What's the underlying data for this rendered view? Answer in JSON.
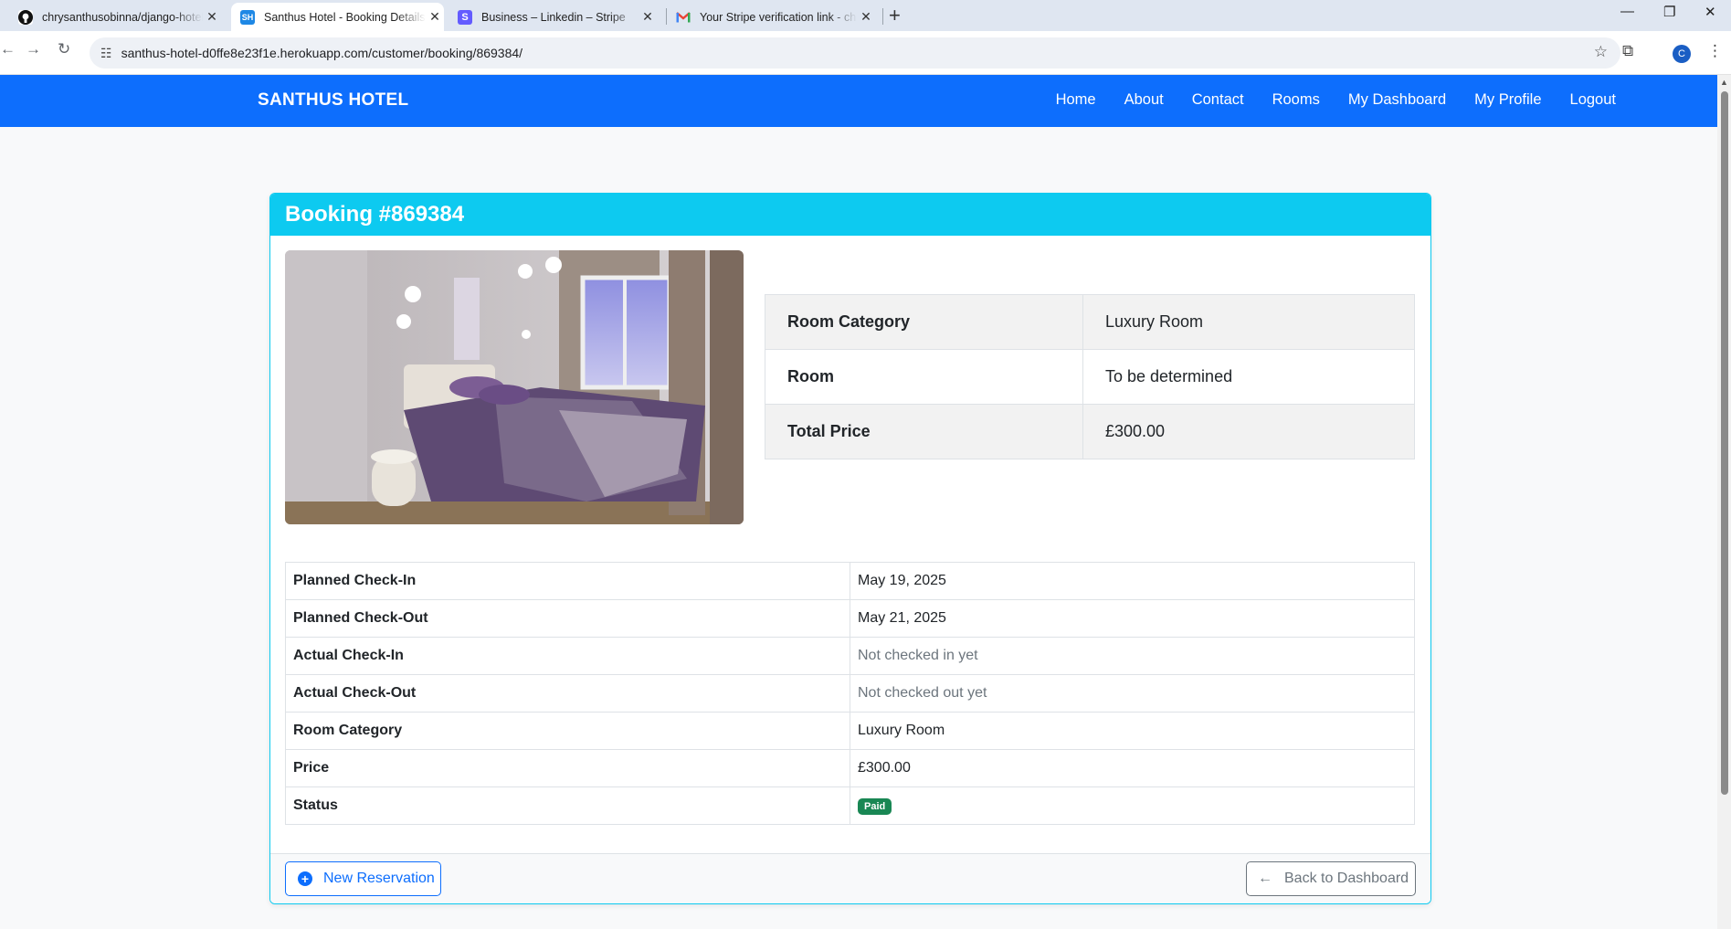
{
  "browser": {
    "tabs": [
      {
        "title": "chrysanthusobinna/django-hotel",
        "favicon": "github-icon"
      },
      {
        "title": "Santhus Hotel - Booking Details",
        "favicon": "SH"
      },
      {
        "title": "Business – Linkedin – Stripe",
        "favicon": "S"
      },
      {
        "title": "Your Stripe verification link - chrysanthus",
        "favicon": "gmail-icon"
      }
    ],
    "url": "santhus-hotel-d0ffe8e23f1e.herokuapp.com/customer/booking/869384/",
    "profile_initial": "C"
  },
  "site": {
    "brand": "SANTHUS HOTEL",
    "nav": [
      "Home",
      "About",
      "Contact",
      "Rooms",
      "My Dashboard",
      "My Profile",
      "Logout"
    ]
  },
  "booking": {
    "title": "Booking #869384",
    "summary": [
      {
        "label": "Room Category",
        "value": "Luxury Room"
      },
      {
        "label": "Room",
        "value": "To be determined"
      },
      {
        "label": "Total Price",
        "value": "£300.00"
      }
    ],
    "details": [
      {
        "label": "Planned Check-In",
        "value": "May 19, 2025"
      },
      {
        "label": "Planned Check-Out",
        "value": "May 21, 2025"
      },
      {
        "label": "Actual Check-In",
        "value": "Not checked in yet"
      },
      {
        "label": "Actual Check-Out",
        "value": "Not checked out yet"
      },
      {
        "label": "Room Category",
        "value": "Luxury Room"
      },
      {
        "label": "Price",
        "value": "£300.00"
      },
      {
        "label": "Status",
        "value": "Paid"
      }
    ],
    "new_reservation_label": "New Reservation",
    "back_label": "Back to Dashboard"
  },
  "colors": {
    "navbar": "#0d6efd",
    "card_header": "#0dcaf0",
    "badge_paid": "#198754"
  }
}
